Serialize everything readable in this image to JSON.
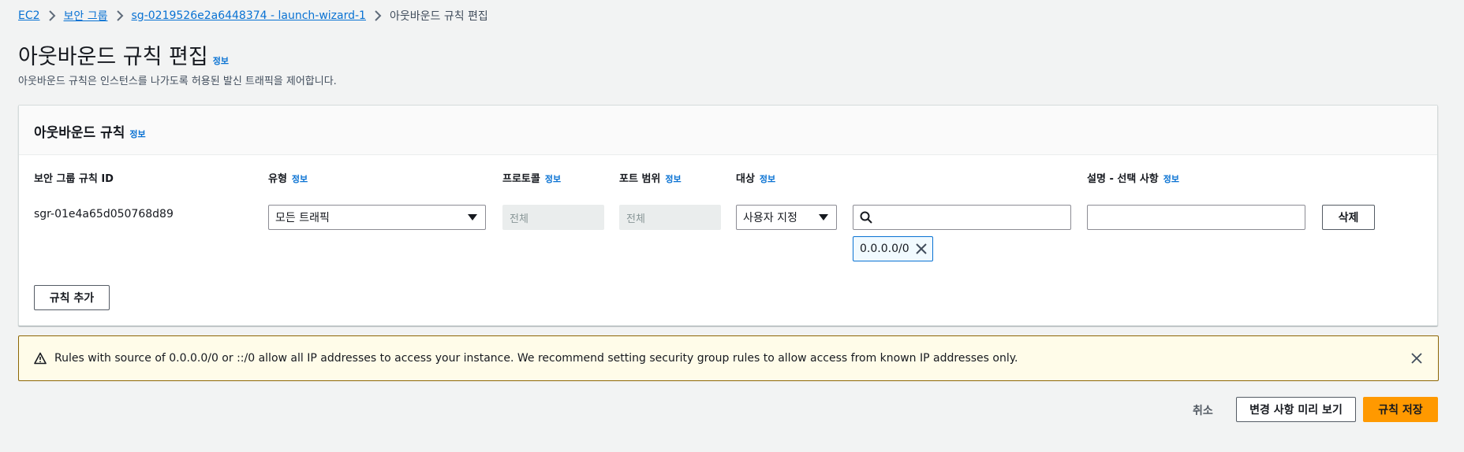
{
  "breadcrumb": {
    "items": [
      "EC2",
      "보안 그룹",
      "sg-0219526e2a6448374 - launch-wizard-1"
    ],
    "current": "아웃바운드 규칙 편집"
  },
  "info_label": "정보",
  "page": {
    "title": "아웃바운드 규칙 편집",
    "description": "아웃바운드 규칙은 인스턴스를 나가도록 허용된 발신 트래픽을 제어합니다."
  },
  "panel": {
    "title": "아웃바운드 규칙",
    "columns": {
      "rule_id": "보안 그룹 규칙 ID",
      "type": "유형",
      "protocol": "프로토콜",
      "port_range": "포트 범위",
      "destination": "대상",
      "description": "설명 - 선택 사항"
    },
    "rule": {
      "id": "sgr-01e4a65d050768d89",
      "type": "모든 트래픽",
      "protocol": "전체",
      "port_range": "전체",
      "destination_type": "사용자 지정",
      "destination_search": "",
      "destination_token": "0.0.0.0/0",
      "description": ""
    },
    "delete_label": "삭제",
    "add_rule_label": "규칙 추가"
  },
  "warning": {
    "text": "Rules with source of 0.0.0.0/0 or ::/0 allow all IP addresses to access your instance. We recommend setting security group rules to allow access from known IP addresses only.",
    "color": "#fffce9"
  },
  "footer": {
    "cancel_label": "취소",
    "preview_label": "변경 사항 미리 보기",
    "save_label": "규칙 저장",
    "save_color": "#ff9900"
  }
}
